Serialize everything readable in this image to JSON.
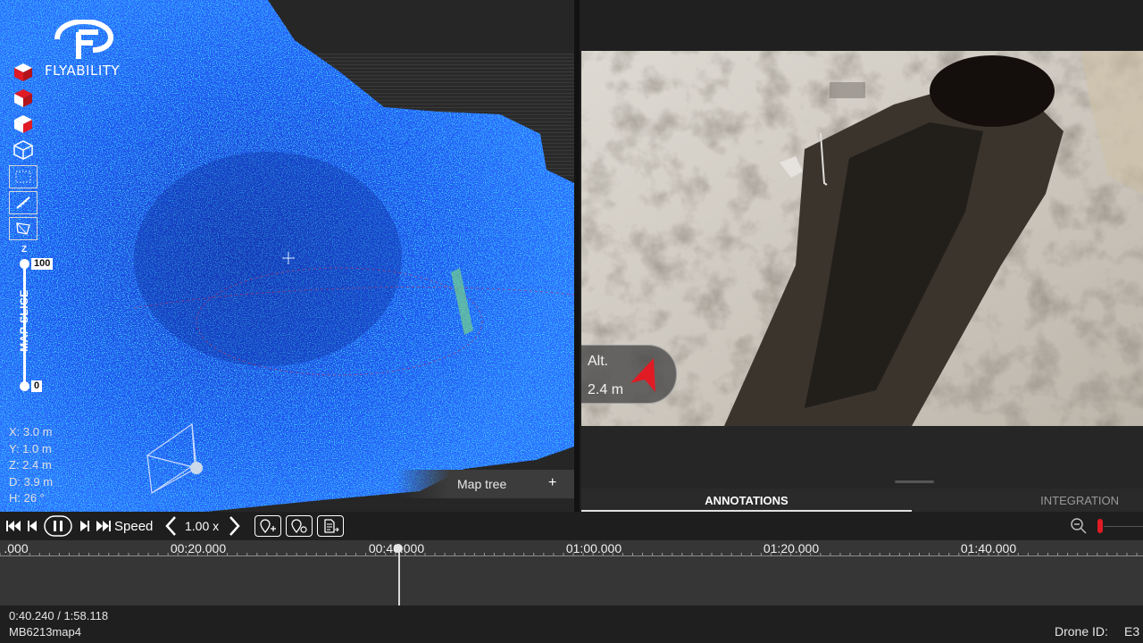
{
  "app": {
    "brand": "FLYABILITY",
    "accent": "#e01b24"
  },
  "map_panel": {
    "tools": [
      {
        "icon": "red-cube-icon"
      },
      {
        "icon": "red-cube-icon"
      },
      {
        "icon": "red-cube-icon"
      },
      {
        "icon": "wireframe-cube-icon"
      },
      {
        "icon": "dotted-square-icon"
      },
      {
        "icon": "ruler-icon"
      },
      {
        "icon": "polygon-measure-icon"
      }
    ],
    "slice": {
      "label": "MAP SLICE",
      "axis": "Z",
      "max": "100",
      "min": "0"
    },
    "coords": {
      "x": "X: 3.0 m",
      "y": "Y: 1.0 m",
      "z": "Z: 2.4 m",
      "d": "D: 3.9 m",
      "h": "H:   26 °"
    },
    "map_tree": {
      "label": "Map tree",
      "plus": "+"
    }
  },
  "camera": {
    "alt_label": "Alt.",
    "alt_value": "2.4 m"
  },
  "tabs": {
    "annotations": "ANNOTATIONS",
    "integration": "INTEGRATION"
  },
  "controls": {
    "speed_label": "Speed",
    "speed_value": "1.00 x",
    "annot_icons": [
      "add-poi-icon",
      "add-poi-photo-icon",
      "export-report-icon"
    ]
  },
  "timeline": {
    "ticks": [
      ".000",
      "00:20.000",
      "00:40.000",
      "01:00.000",
      "01:20.000",
      "01:40.000"
    ],
    "position": 0.3388
  },
  "status": {
    "time": "0:40.240 / 1:58.118",
    "map_name": "MB6213map4",
    "drone_label": "Drone ID:",
    "drone_value": "E3"
  }
}
